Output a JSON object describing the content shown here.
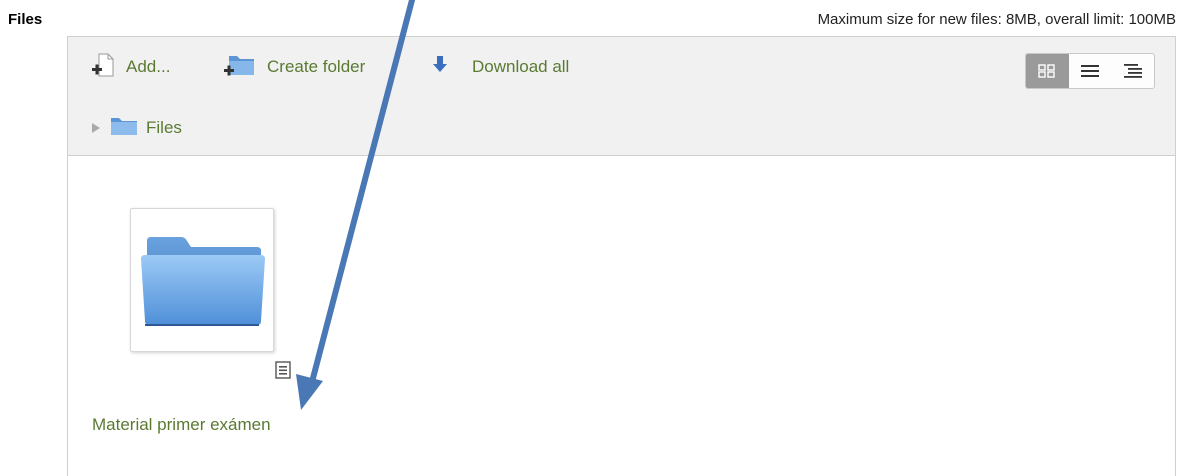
{
  "header": {
    "title": "Files",
    "limits": "Maximum size for new files: 8MB, overall limit: 100MB"
  },
  "toolbar": {
    "add_label": "Add...",
    "create_folder_label": "Create folder",
    "download_all_label": "Download all"
  },
  "view_modes": [
    "icons",
    "list",
    "tree"
  ],
  "active_view": "icons",
  "path": {
    "current": "Files"
  },
  "items": [
    {
      "name": "Material primer exámen",
      "type": "folder"
    }
  ],
  "colors": {
    "link": "#5a7a32",
    "toolbar_bg": "#f1f1f1",
    "annotation_arrow": "#4a78b5"
  }
}
